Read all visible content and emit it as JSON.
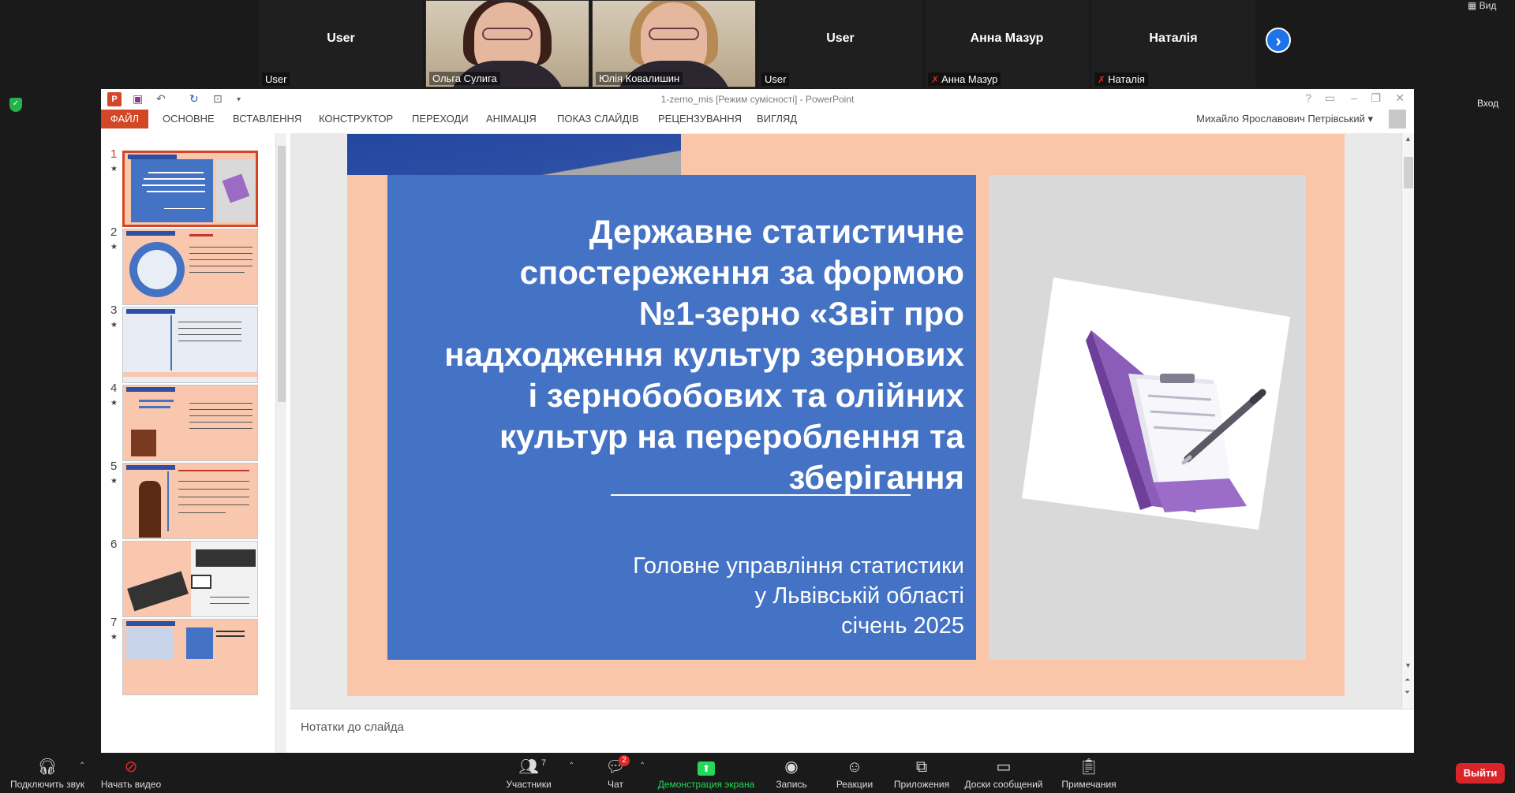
{
  "participants": [
    {
      "center": "User",
      "corner": "User",
      "muted": false,
      "video": false
    },
    {
      "center": "",
      "corner": "Ольга Сулига",
      "muted": false,
      "video": true
    },
    {
      "center": "",
      "corner": "Юлія Ковалишин",
      "muted": false,
      "video": true
    },
    {
      "center": "User",
      "corner": "User",
      "muted": false,
      "video": false
    },
    {
      "center": "Анна Мазур",
      "corner": "Анна Мазур",
      "muted": true,
      "video": false
    },
    {
      "center": "Наталія",
      "corner": "Наталія",
      "muted": true,
      "video": false
    }
  ],
  "zoom": {
    "view_label": "Вид",
    "enter_label": "Вход",
    "next_arrow": "›"
  },
  "ppt": {
    "doc_title": "1-zerno_mis [Режим сумісності] - PowerPoint",
    "logo": "P",
    "user_name": "Михайло Ярославович Петрівський",
    "tabs": [
      "ФАЙЛ",
      "ОСНОВНЕ",
      "ВСТАВЛЕННЯ",
      "КОНСТРУКТОР",
      "ПЕРЕХОДИ",
      "АНІМАЦІЯ",
      "ПОКАЗ СЛАЙДІВ",
      "РЕЦЕНЗУВАННЯ",
      "ВИГЛЯД"
    ],
    "thumbnails": [
      "1",
      "2",
      "3",
      "4",
      "5",
      "6",
      "7"
    ],
    "slide": {
      "title_lines": [
        "Державне статистичне",
        "спостереження за формою",
        "№1-зерно «Звіт про",
        "надходження культур зернових",
        "і зернобобових та олійних",
        "культур на перероблення та",
        "зберігання"
      ],
      "subtitle_lines": [
        "Головне управління статистики",
        "у Львівській області",
        "січень 2025"
      ]
    },
    "notes_placeholder": "Нотатки до слайда"
  },
  "toolbar": {
    "audio": "Подключить звук",
    "video": "Начать видео",
    "participants": "Участники",
    "participants_count": "7",
    "chat": "Чат",
    "chat_badge": "2",
    "share": "Демонстрация экрана",
    "record": "Запись",
    "reactions": "Реакции",
    "apps": "Приложения",
    "whiteboards": "Доски сообщений",
    "notes": "Примечания",
    "leave": "Выйти"
  },
  "colors": {
    "ppt_accent": "#d24726",
    "slide_blue": "#4472c4",
    "slide_peach": "#f9c6aa",
    "zoom_green": "#23d959",
    "leave_red": "#d9242a"
  }
}
